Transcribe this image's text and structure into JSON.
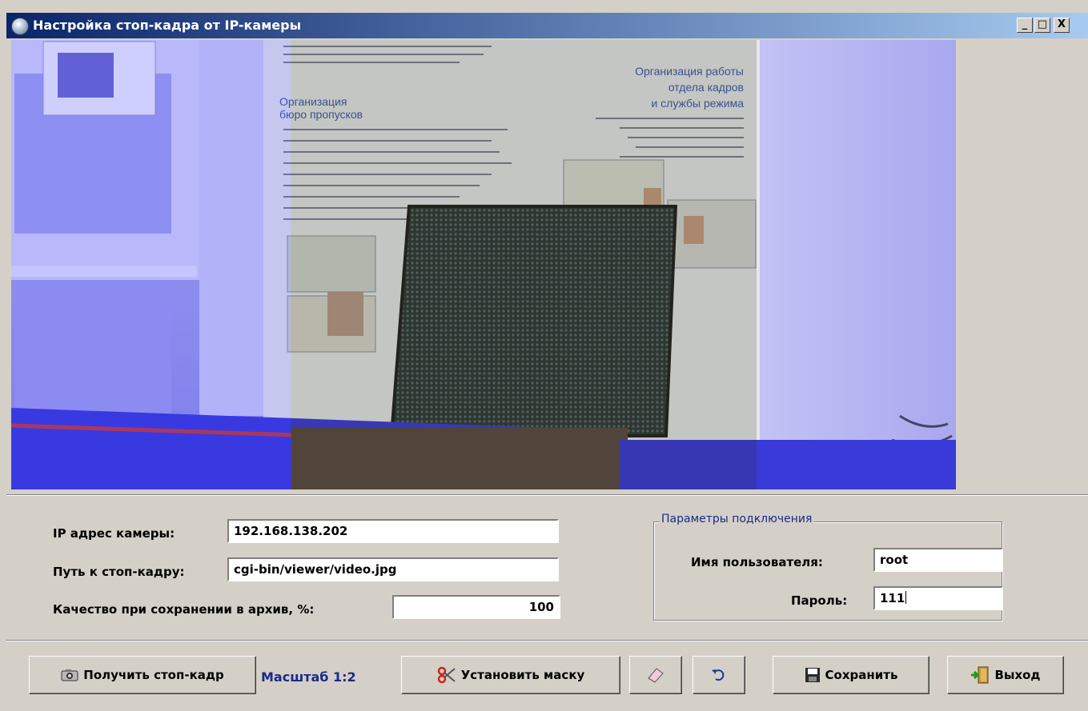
{
  "window": {
    "title": "Настройка стоп-кадра от IP-камеры",
    "controls": {
      "minimize": "_",
      "maximize": "□",
      "close": "X"
    }
  },
  "preview": {
    "poster_heading_left_1": "Организация",
    "poster_heading_left_2": "бюро пропусков",
    "poster_heading_right_1": "Организация работы",
    "poster_heading_right_2": "отдела кадров",
    "poster_heading_right_3": "и службы режима"
  },
  "form": {
    "ip_label": "IP адрес камеры:",
    "ip_value": "192.168.138.202",
    "path_label": "Путь к стоп-кадру:",
    "path_value": "cgi-bin/viewer/video.jpg",
    "quality_label": "Качество при сохранении в архив, %:",
    "quality_value": "100"
  },
  "connection": {
    "group_title": "Параметры подключения",
    "username_label": "Имя пользователя:",
    "username_value": "root",
    "password_label": "Пароль:",
    "password_value": "111"
  },
  "toolbar": {
    "get_frame_label": "Получить стоп-кадр",
    "scale_label": "Масштаб 1:2",
    "set_mask_label": "Установить маску",
    "save_label": "Сохранить",
    "exit_label": "Выход"
  }
}
